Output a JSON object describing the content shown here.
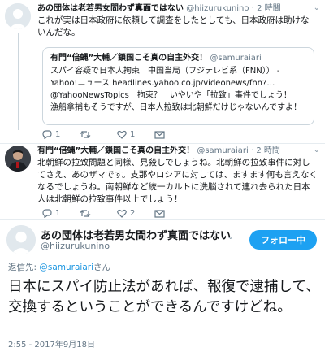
{
  "tweet1": {
    "name": "あの団体は老若男女問わず真面ではない",
    "handle": "@hiizurukunino",
    "dot": "·",
    "time": "2 時間",
    "text": "これが実は日本政府に依頼して調査をしたとしても、日本政府は助けないんだな。",
    "quote": {
      "name": "有門“倍蝿”大輔／鎖国こそ真の自主外交！",
      "handle": "@samuraiari",
      "text": "スパイ容疑で日本人拘束　中国当局（フジテレビ系（FNN））  - Yahoo!ニュース headlines.yahoo.co.jp/videonews/fnn?… @YahooNewsTopics　拘束？　いやいや「拉致」事件でしょう！　漁船拿捕もそうですが、日本人拉致は北朝鮮だけじゃないんですよ！"
    },
    "reply_count": "1",
    "retweet_count": "",
    "like_count": "1"
  },
  "tweet2": {
    "name": "有門“倍蝿”大輔／鎖国こそ真の自主外交！",
    "handle": "@samuraiari",
    "dot": "·",
    "time": "2 時間",
    "text": "北朝鮮の拉致問題と同様、見殺しでしょうね。北朝鮮の拉致事件に対してさえ、あのザマです。支那やロシアに対しては、ますます何も言えなくなるでしょうね。南朝鮮など統一カルトに洗脳されて連れ去られた日本人は北朝鮮の拉致事件以上でしょう！",
    "reply_count": "1",
    "retweet_count": "",
    "like_count": "2"
  },
  "main": {
    "name": "あの団体は老若男女問わず真面ではない",
    "handle": "@hiizurukunino",
    "follow_label": "フォロー中",
    "reply_prefix": "返信先: ",
    "reply_mention": "@samuraiari",
    "reply_suffix": "さん",
    "text": "日本にスパイ防止法があれば、報復で逮捕して、交換するということができるんですけどね。",
    "timestamp": "2:55 - 2017年9月18日"
  },
  "icons": {
    "reply": "reply-icon",
    "retweet": "retweet-icon",
    "like": "heart-icon",
    "dm": "envelope-icon",
    "caret": "chevron-down-icon"
  },
  "colors": {
    "accent": "#1da1f2",
    "link": "#1b95e0",
    "muted": "#657786"
  }
}
